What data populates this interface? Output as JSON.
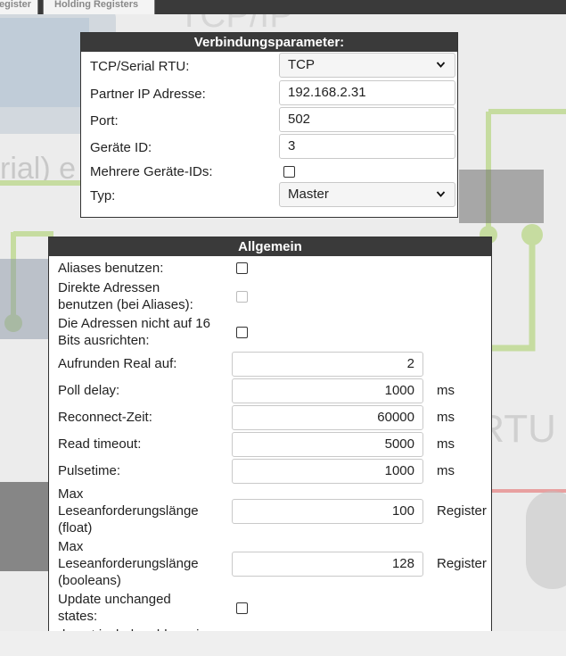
{
  "tabs": [
    {
      "label": "egister"
    },
    {
      "label": "Holding Registers"
    }
  ],
  "connection": {
    "title": "Verbindungsparameter:",
    "tcp_serial_label": "TCP/Serial RTU:",
    "tcp_serial_value": "TCP",
    "ip_label": "Partner IP Adresse:",
    "ip_value": "192.168.2.31",
    "port_label": "Port:",
    "port_value": "502",
    "device_id_label": "Geräte ID:",
    "device_id_value": "3",
    "multi_ids_label": "Mehrere Geräte-IDs:",
    "multi_ids_checked": false,
    "type_label": "Typ:",
    "type_value": "Master"
  },
  "general": {
    "title": "Allgemein",
    "aliases_label": "Aliases benutzen:",
    "direct_label_1": "Direkte Adressen",
    "direct_label_2": "benutzen (bei Aliases):",
    "align_label_1": "Die Adressen nicht auf 16",
    "align_label_2": "Bits ausrichten:",
    "round_label": "Aufrunden Real auf:",
    "round_value": "2",
    "poll_label": "Poll delay:",
    "poll_value": "1000",
    "poll_unit": "ms",
    "reconnect_label": "Reconnect-Zeit:",
    "reconnect_value": "60000",
    "reconnect_unit": "ms",
    "read_timeout_label": "Read timeout:",
    "read_timeout_value": "5000",
    "read_timeout_unit": "ms",
    "pulse_label": "Pulsetime:",
    "pulse_value": "1000",
    "pulse_unit": "ms",
    "max_float_label_1": "Max",
    "max_float_label_2": "Leseanforderungslänge",
    "max_float_label_3": "(float)",
    "max_float_value": "100",
    "max_float_unit": "Register",
    "max_bool_label_1": "Max",
    "max_bool_label_2": "Leseanforderungslänge",
    "max_bool_label_3": "(booleans)",
    "max_bool_value": "128",
    "max_bool_unit": "Register",
    "update_label_1": "Update unchanged",
    "update_label_2": "states:",
    "cut_label": "do not include address in"
  },
  "icons": {
    "dropdown": "chevron-down-icon",
    "checkbox": "checkbox-icon"
  }
}
